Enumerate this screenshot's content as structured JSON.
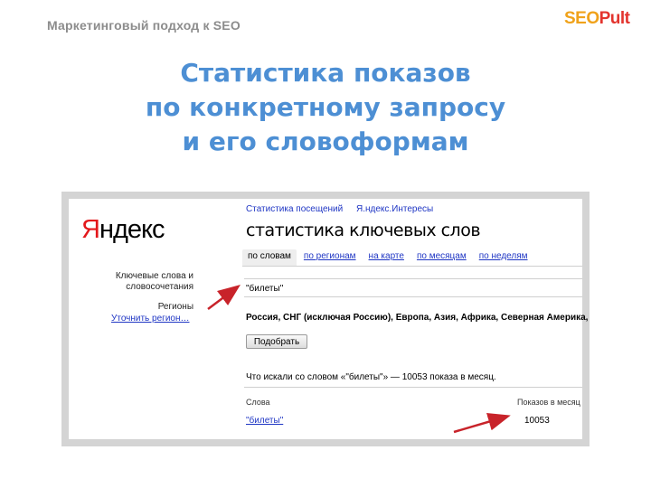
{
  "slide": {
    "header": "Маркетинговый подход к SEO",
    "logo_a": "SEO",
    "logo_b": "Pult",
    "title_lines": [
      "Статистика показов",
      "по конкретному запросу",
      "и его словоформам"
    ]
  },
  "yandex": {
    "logo_first": "Я",
    "logo_rest": "ндекс",
    "breadcrumbs": [
      "Статистика посещений",
      "Я.ндекс.Интересы"
    ],
    "page_title": "статистика ключевых слов",
    "tabs": [
      "по словам",
      "по регионам",
      "на карте",
      "по месяцам",
      "по неделям"
    ],
    "active_tab": "по словам",
    "left_label_keywords": "Ключевые слова и словосочетания",
    "left_label_regions": "Регионы",
    "left_link_refine": "Уточнить регион…",
    "query_value": "\"билеты\"",
    "regions_value": "Россия, СНГ (исключая Россию), Европа, Азия, Африка, Северная Америка,",
    "submit_label": "Подобрать",
    "summary": "Что искали со словом «\"билеты\"» — 10053 показа в месяц.",
    "table_header_word": "Слова",
    "table_header_count": "Показов в месяц",
    "row_word": "\"билеты\"",
    "row_count": "10053"
  },
  "colors": {
    "title": "#4d8fd4",
    "arrow": "#c8232a",
    "link": "#1f36c4"
  }
}
